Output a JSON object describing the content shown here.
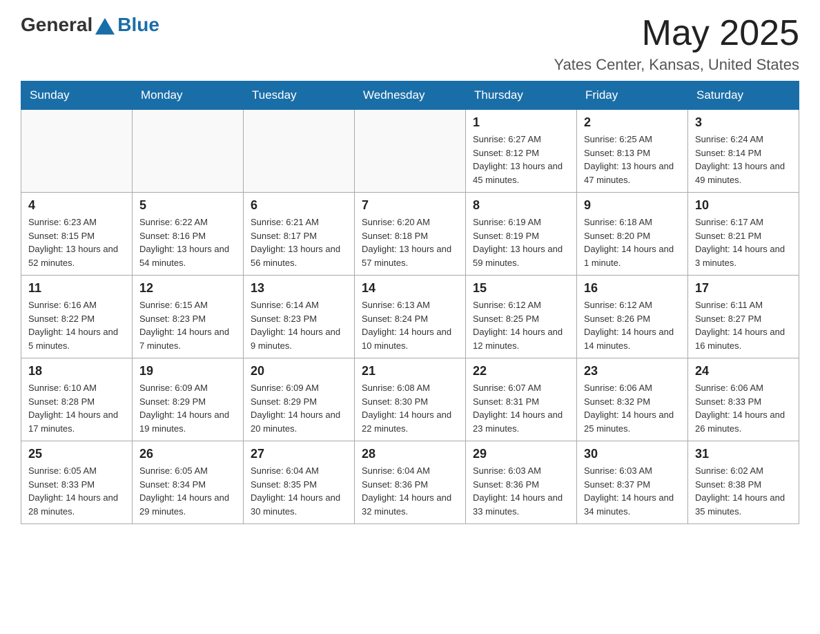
{
  "header": {
    "logo_general": "General",
    "logo_blue": "Blue",
    "month": "May 2025",
    "location": "Yates Center, Kansas, United States"
  },
  "days_of_week": [
    "Sunday",
    "Monday",
    "Tuesday",
    "Wednesday",
    "Thursday",
    "Friday",
    "Saturday"
  ],
  "weeks": [
    [
      {
        "day": "",
        "info": ""
      },
      {
        "day": "",
        "info": ""
      },
      {
        "day": "",
        "info": ""
      },
      {
        "day": "",
        "info": ""
      },
      {
        "day": "1",
        "info": "Sunrise: 6:27 AM\nSunset: 8:12 PM\nDaylight: 13 hours and 45 minutes."
      },
      {
        "day": "2",
        "info": "Sunrise: 6:25 AM\nSunset: 8:13 PM\nDaylight: 13 hours and 47 minutes."
      },
      {
        "day": "3",
        "info": "Sunrise: 6:24 AM\nSunset: 8:14 PM\nDaylight: 13 hours and 49 minutes."
      }
    ],
    [
      {
        "day": "4",
        "info": "Sunrise: 6:23 AM\nSunset: 8:15 PM\nDaylight: 13 hours and 52 minutes."
      },
      {
        "day": "5",
        "info": "Sunrise: 6:22 AM\nSunset: 8:16 PM\nDaylight: 13 hours and 54 minutes."
      },
      {
        "day": "6",
        "info": "Sunrise: 6:21 AM\nSunset: 8:17 PM\nDaylight: 13 hours and 56 minutes."
      },
      {
        "day": "7",
        "info": "Sunrise: 6:20 AM\nSunset: 8:18 PM\nDaylight: 13 hours and 57 minutes."
      },
      {
        "day": "8",
        "info": "Sunrise: 6:19 AM\nSunset: 8:19 PM\nDaylight: 13 hours and 59 minutes."
      },
      {
        "day": "9",
        "info": "Sunrise: 6:18 AM\nSunset: 8:20 PM\nDaylight: 14 hours and 1 minute."
      },
      {
        "day": "10",
        "info": "Sunrise: 6:17 AM\nSunset: 8:21 PM\nDaylight: 14 hours and 3 minutes."
      }
    ],
    [
      {
        "day": "11",
        "info": "Sunrise: 6:16 AM\nSunset: 8:22 PM\nDaylight: 14 hours and 5 minutes."
      },
      {
        "day": "12",
        "info": "Sunrise: 6:15 AM\nSunset: 8:23 PM\nDaylight: 14 hours and 7 minutes."
      },
      {
        "day": "13",
        "info": "Sunrise: 6:14 AM\nSunset: 8:23 PM\nDaylight: 14 hours and 9 minutes."
      },
      {
        "day": "14",
        "info": "Sunrise: 6:13 AM\nSunset: 8:24 PM\nDaylight: 14 hours and 10 minutes."
      },
      {
        "day": "15",
        "info": "Sunrise: 6:12 AM\nSunset: 8:25 PM\nDaylight: 14 hours and 12 minutes."
      },
      {
        "day": "16",
        "info": "Sunrise: 6:12 AM\nSunset: 8:26 PM\nDaylight: 14 hours and 14 minutes."
      },
      {
        "day": "17",
        "info": "Sunrise: 6:11 AM\nSunset: 8:27 PM\nDaylight: 14 hours and 16 minutes."
      }
    ],
    [
      {
        "day": "18",
        "info": "Sunrise: 6:10 AM\nSunset: 8:28 PM\nDaylight: 14 hours and 17 minutes."
      },
      {
        "day": "19",
        "info": "Sunrise: 6:09 AM\nSunset: 8:29 PM\nDaylight: 14 hours and 19 minutes."
      },
      {
        "day": "20",
        "info": "Sunrise: 6:09 AM\nSunset: 8:29 PM\nDaylight: 14 hours and 20 minutes."
      },
      {
        "day": "21",
        "info": "Sunrise: 6:08 AM\nSunset: 8:30 PM\nDaylight: 14 hours and 22 minutes."
      },
      {
        "day": "22",
        "info": "Sunrise: 6:07 AM\nSunset: 8:31 PM\nDaylight: 14 hours and 23 minutes."
      },
      {
        "day": "23",
        "info": "Sunrise: 6:06 AM\nSunset: 8:32 PM\nDaylight: 14 hours and 25 minutes."
      },
      {
        "day": "24",
        "info": "Sunrise: 6:06 AM\nSunset: 8:33 PM\nDaylight: 14 hours and 26 minutes."
      }
    ],
    [
      {
        "day": "25",
        "info": "Sunrise: 6:05 AM\nSunset: 8:33 PM\nDaylight: 14 hours and 28 minutes."
      },
      {
        "day": "26",
        "info": "Sunrise: 6:05 AM\nSunset: 8:34 PM\nDaylight: 14 hours and 29 minutes."
      },
      {
        "day": "27",
        "info": "Sunrise: 6:04 AM\nSunset: 8:35 PM\nDaylight: 14 hours and 30 minutes."
      },
      {
        "day": "28",
        "info": "Sunrise: 6:04 AM\nSunset: 8:36 PM\nDaylight: 14 hours and 32 minutes."
      },
      {
        "day": "29",
        "info": "Sunrise: 6:03 AM\nSunset: 8:36 PM\nDaylight: 14 hours and 33 minutes."
      },
      {
        "day": "30",
        "info": "Sunrise: 6:03 AM\nSunset: 8:37 PM\nDaylight: 14 hours and 34 minutes."
      },
      {
        "day": "31",
        "info": "Sunrise: 6:02 AM\nSunset: 8:38 PM\nDaylight: 14 hours and 35 minutes."
      }
    ]
  ]
}
